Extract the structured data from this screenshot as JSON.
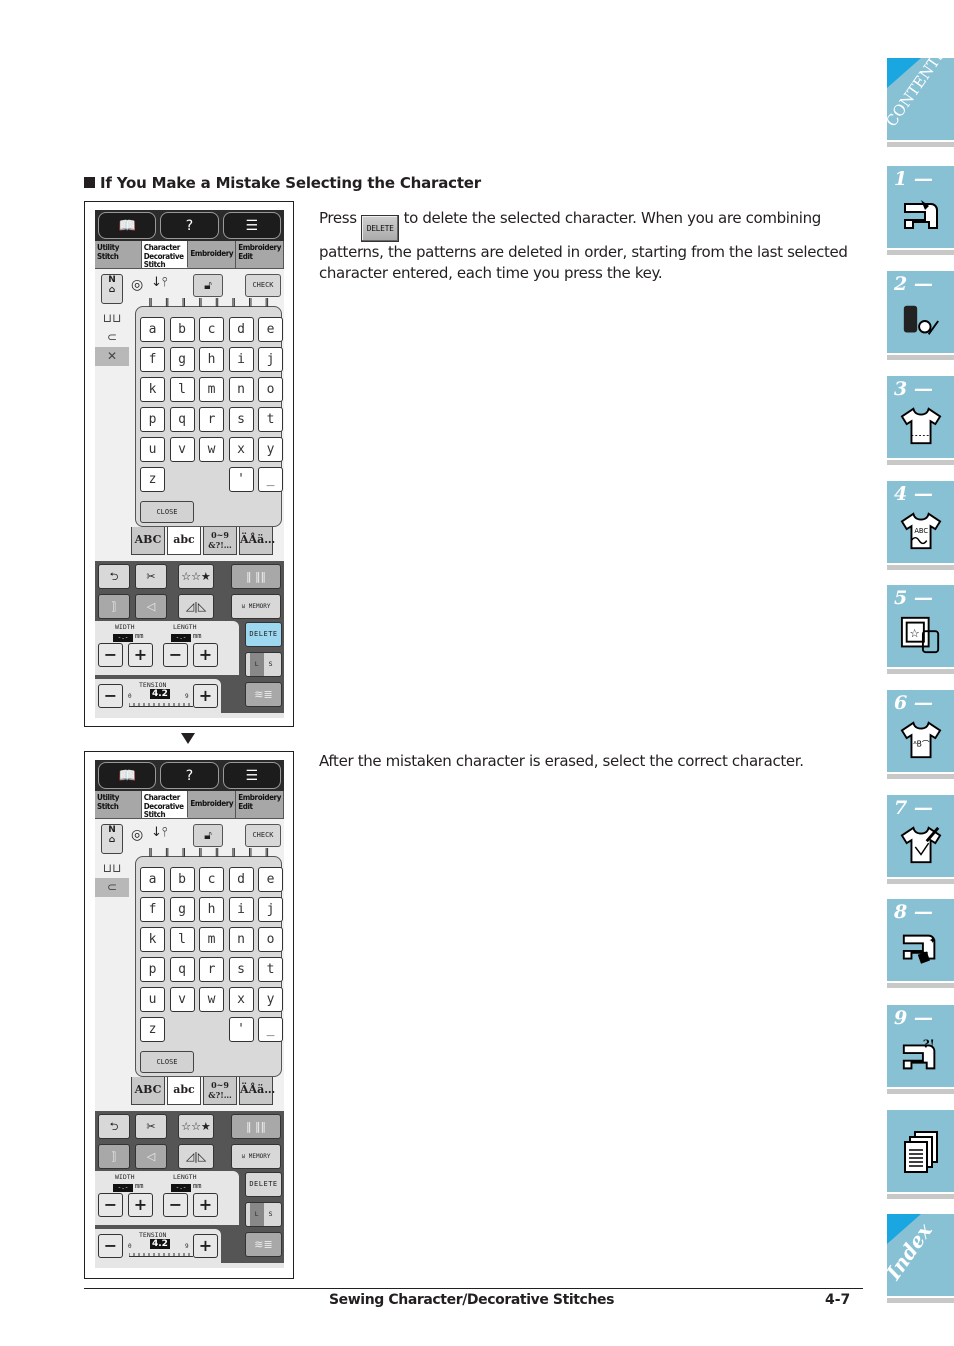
{
  "heading": "If You Make a Mistake Selecting the Character",
  "paragraph1": {
    "before_key": "Press",
    "key_label": "DELETE",
    "after_key": "to delete the selected character. When you are combining patterns, the patterns are deleted in order, starting from the last selected character entered, each time you press the key."
  },
  "paragraph2": "After the mistaken character is erased, select the correct character.",
  "screens": [
    {
      "tabs": [
        "Utility Stitch",
        "Character Decorative Stitch",
        "Embroidery",
        "Embroidery Edit"
      ],
      "active_tab": 1,
      "check_label": "CHECK",
      "side_selected": "x-icon",
      "keys": [
        "a",
        "b",
        "c",
        "d",
        "e",
        "f",
        "g",
        "h",
        "i",
        "j",
        "k",
        "l",
        "m",
        "n",
        "o",
        "p",
        "q",
        "r",
        "s",
        "t",
        "u",
        "v",
        "w",
        "x",
        "y",
        "z",
        "",
        "",
        "'",
        "_"
      ],
      "close_label": "CLOSE",
      "charset_tabs": [
        "ABC",
        "abc",
        "0~9 &?!…",
        "ÄÅä…"
      ],
      "active_charset": 1,
      "memory_label": "MEMORY",
      "delete_label": "DELETE",
      "delete_highlighted": true,
      "width_label": "WIDTH",
      "length_label": "LENGTH",
      "width_value": "-.-",
      "length_value": "-.-",
      "unit": "mm",
      "tension_label": "TENSION",
      "tension_value": "4.2",
      "tension_min": "0",
      "tension_max": "9",
      "ls_labels": [
        "L",
        "S"
      ]
    },
    {
      "tabs": [
        "Utility Stitch",
        "Character Decorative Stitch",
        "Embroidery",
        "Embroidery Edit"
      ],
      "active_tab": 1,
      "check_label": "CHECK",
      "side_selected": "c-shape-icon",
      "keys": [
        "a",
        "b",
        "c",
        "d",
        "e",
        "f",
        "g",
        "h",
        "i",
        "j",
        "k",
        "l",
        "m",
        "n",
        "o",
        "p",
        "q",
        "r",
        "s",
        "t",
        "u",
        "v",
        "w",
        "x",
        "y",
        "z",
        "",
        "",
        "'",
        "_"
      ],
      "close_label": "CLOSE",
      "charset_tabs": [
        "ABC",
        "abc",
        "0~9 &?!…",
        "ÄÅä…"
      ],
      "active_charset": 1,
      "memory_label": "MEMORY",
      "delete_label": "DELETE",
      "delete_highlighted": false,
      "width_label": "WIDTH",
      "length_label": "LENGTH",
      "width_value": "-.-",
      "length_value": "-.-",
      "unit": "mm",
      "tension_label": "TENSION",
      "tension_value": "4.2",
      "tension_min": "0",
      "tension_max": "9",
      "ls_labels": [
        "L",
        "S"
      ]
    }
  ],
  "footer": {
    "title": "Sewing Character/Decorative Stitches",
    "page": "4-7"
  },
  "nav": {
    "contents": "CONTENTS",
    "chapters": [
      {
        "num": "1 —",
        "icon": "sewing-machine-icon"
      },
      {
        "num": "2 —",
        "icon": "thread-spool-scissors-icon"
      },
      {
        "num": "3 —",
        "icon": "shirt-stitch-icon"
      },
      {
        "num": "4 —",
        "icon": "shirt-abc-icon"
      },
      {
        "num": "5 —",
        "icon": "embroidery-frame-icon"
      },
      {
        "num": "6 —",
        "icon": "shirt-edit-icon"
      },
      {
        "num": "7 —",
        "icon": "shirt-needle-icon"
      },
      {
        "num": "8 —",
        "icon": "machine-maintenance-icon"
      },
      {
        "num": "9 —",
        "icon": "machine-troubleshoot-icon"
      }
    ],
    "appendix_icon": "documents-icon",
    "index": "Index"
  },
  "colors": {
    "nav_tab": "#89c1d4",
    "nav_corner": "#1aa6e0",
    "delete_highlight": "#9ed8f0"
  }
}
